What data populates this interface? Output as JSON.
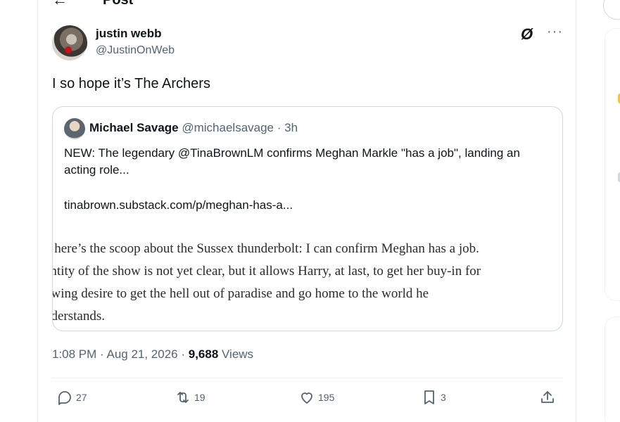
{
  "header": {
    "back_label": "←",
    "title": "Post"
  },
  "author": {
    "name": "justin webb",
    "handle": "@JustinOnWeb"
  },
  "tweet": {
    "text": "I so hope it’s The Archers"
  },
  "quote": {
    "name": "Michael Savage",
    "handle_time": "@michaelsavage · 3h",
    "text": "NEW: The legendary @TinaBrownLM confirms Meghan Markle \"has a job\", landing an acting role...",
    "link": "tinabrown.substack.com/p/meghan-has-a...",
    "excerpt": [
      "o here’s the scoop about the Sussex thunderbolt: I can confirm Meghan has a job.",
      "entity of the show is not yet clear, but it allows Harry, at last, to get her buy-in for",
      "owing desire to get the hell out of paradise and go home to the world he",
      "nderstands."
    ]
  },
  "meta": {
    "time_date": "1:08 PM · Aug 21, 2026 · ",
    "views_count": "9,688",
    "views_label": " Views"
  },
  "actions": {
    "replies": "27",
    "reposts": "19",
    "likes": "195",
    "bookmarks": "3"
  },
  "colors": {
    "text": "#0f1419",
    "secondary": "#536471",
    "border": "#cfd9de"
  }
}
